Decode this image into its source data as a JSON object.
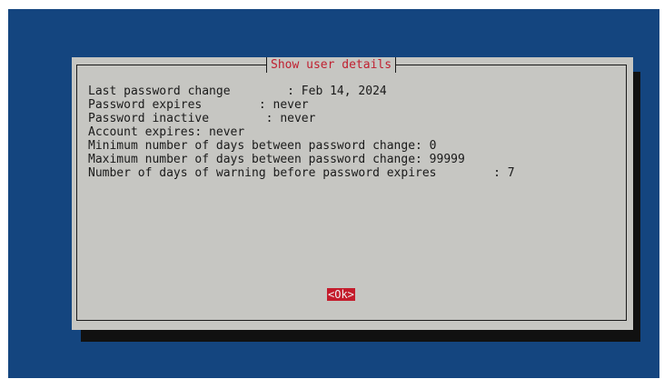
{
  "dialog": {
    "title": "Show user details",
    "lines": [
      "Last password change        : Feb 14, 2024",
      "Password expires        : never",
      "Password inactive        : never",
      "Account expires: never",
      "Minimum number of days between password change: 0",
      "Maximum number of days between password change: 99999",
      "Number of days of warning before password expires        : 7"
    ],
    "ok_label": "<Ok>"
  },
  "colors": {
    "background": "#14457f",
    "dialog": "#c6c6c2",
    "accent": "#c41c2c",
    "text": "#1a1a1a"
  }
}
